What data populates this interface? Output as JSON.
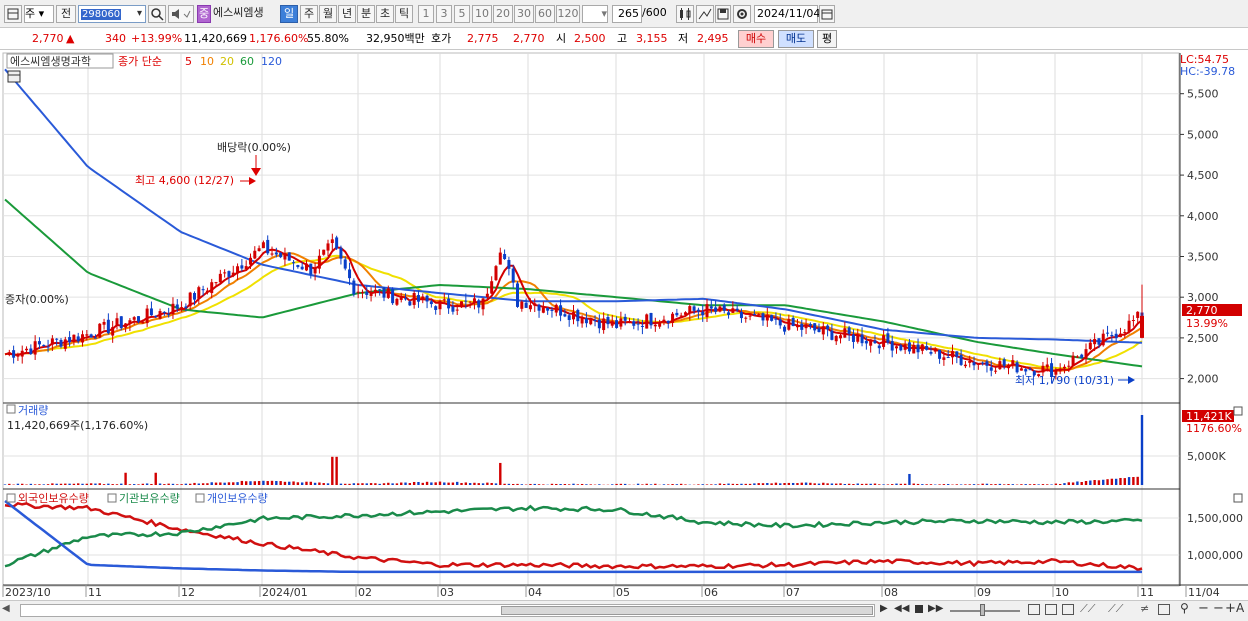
{
  "toolbar": {
    "market_label": "주",
    "prev_label": "전",
    "stock_code": "298060",
    "badge_label": "중",
    "stock_name": "에스씨엠생",
    "period_tabs": [
      "일",
      "주",
      "월",
      "년",
      "분",
      "초",
      "틱"
    ],
    "intervals": [
      "1",
      "3",
      "5",
      "10",
      "20",
      "30",
      "60",
      "120"
    ],
    "count": "265",
    "count_total": "/600",
    "date": "2024/11/04"
  },
  "quote": {
    "price": "2,770",
    "arrow": "▲",
    "change": "340",
    "change_pct": "+13.99%",
    "volume": "11,420,669",
    "volume_pct": "1,176.60%",
    "turnover_pct": "55.80%",
    "amount": "32,950백만",
    "ask_label": "호가",
    "ask": "2,775",
    "bid": "2,770",
    "open_label": "시",
    "open": "2,500",
    "high_label": "고",
    "high": "3,155",
    "low_label": "저",
    "low": "2,495",
    "buy_label": "매수",
    "sell_label": "매도",
    "eval_label": "평"
  },
  "price_panel": {
    "stock_title": "에스씨엠생명과학",
    "ma_label": "종가 단순",
    "ma_periods": [
      "5",
      "10",
      "20",
      "60",
      "120"
    ],
    "lc": "LC:54.75",
    "hc": "HC:-39.78",
    "y_ticks": [
      "5,500",
      "5,000",
      "4,500",
      "4,000",
      "3,500",
      "3,000",
      "2,500",
      "2,000"
    ],
    "current_price_tag": "2,770",
    "current_pct_tag": "13.99%",
    "dividend_label": "배당락(0.00%)",
    "high_annotation": "최고 4,600 (12/27)",
    "low_annotation": "최저 1,790 (10/31)",
    "left_label": "증자(0.00%)"
  },
  "volume_panel": {
    "title": "거래량",
    "value": "11,420,669주(1,176.60%)",
    "y_tick": "5,000K",
    "tag_value": "11,421K",
    "tag_pct": "1176.60%"
  },
  "holding_panel": {
    "legend": [
      "외국인보유수량",
      "기관보유수량",
      "개인보유수량"
    ],
    "y_ticks": [
      "1,500,000",
      "1,000,000"
    ]
  },
  "x_axis": [
    "2023/10",
    "11",
    "12",
    "2024/01",
    "02",
    "03",
    "04",
    "05",
    "06",
    "07",
    "08",
    "09",
    "10",
    "11",
    "11/04"
  ],
  "colors": {
    "up": "#d20000",
    "down": "#0a3fc8",
    "ma5": "#d20000",
    "ma10": "#f08000",
    "ma20": "#f0e000",
    "ma60": "#1a9a3a",
    "ma120": "#2a5ad8",
    "foreign": "#d01010",
    "institution": "#1a8a4a",
    "individual": "#2a5ad8"
  },
  "icons": [
    "chart-type-icon",
    "search-icon",
    "speaker-icon",
    "candle-icon",
    "draw-icon",
    "save-icon",
    "gear-icon",
    "calendar-icon"
  ],
  "chart_data": [
    {
      "type": "line",
      "title": "에스씨엠생명과학 일봉",
      "x": [
        "2023/10",
        "11",
        "12",
        "2024/01",
        "02",
        "03",
        "04",
        "05",
        "06",
        "07",
        "08",
        "09",
        "10",
        "11"
      ],
      "series": [
        {
          "name": "종가",
          "values": [
            2300,
            2550,
            2900,
            3600,
            3100,
            2900,
            2950,
            2650,
            2850,
            2650,
            2450,
            2200,
            2100,
            2770
          ]
        },
        {
          "name": "120",
          "values": [
            5800,
            4600,
            3800,
            3400,
            3150,
            3050,
            2950,
            2950,
            2980,
            2850,
            2600,
            2500,
            2480,
            2440
          ]
        },
        {
          "name": "60",
          "values": [
            4200,
            3300,
            2850,
            2750,
            3050,
            3150,
            3100,
            3000,
            2900,
            2900,
            2700,
            2450,
            2300,
            2150
          ]
        }
      ],
      "ylim": [
        1700,
        6000
      ]
    },
    {
      "type": "bar",
      "title": "거래량",
      "ylabel": "주",
      "x": [
        "2023/10",
        "11",
        "12",
        "2024/01",
        "02",
        "03",
        "04",
        "05",
        "06",
        "07",
        "08",
        "09",
        "10",
        "11"
      ],
      "values": [
        500,
        900,
        700,
        5200,
        800,
        3500,
        400,
        300,
        300,
        2200,
        600,
        300,
        500,
        11421
      ]
    },
    {
      "type": "line",
      "title": "보유수량",
      "x": [
        "2023/10",
        "11",
        "12",
        "2024/01",
        "02",
        "03",
        "04",
        "05",
        "06",
        "07",
        "08",
        "09",
        "10",
        "11"
      ],
      "series": [
        {
          "name": "외국인보유수량",
          "values": [
            1750000,
            1700000,
            1400000,
            1200000,
            1000000,
            900000,
            900000,
            880000,
            880000,
            900000,
            950000,
            920000,
            950000,
            850000
          ]
        },
        {
          "name": "기관보유수량",
          "values": [
            900000,
            1300000,
            1350000,
            1550000,
            1600000,
            1650000,
            1700000,
            1680000,
            1500000,
            1450000,
            1500000,
            1520000,
            1500000,
            1520000
          ]
        },
        {
          "name": "개인보유수량",
          "values": [
            1800000,
            900000,
            850000,
            820000,
            800000,
            800000,
            800000,
            800000,
            800000,
            800000,
            800000,
            800000,
            800000,
            800000
          ]
        }
      ],
      "ylim": [
        700000,
        1800000
      ]
    }
  ]
}
